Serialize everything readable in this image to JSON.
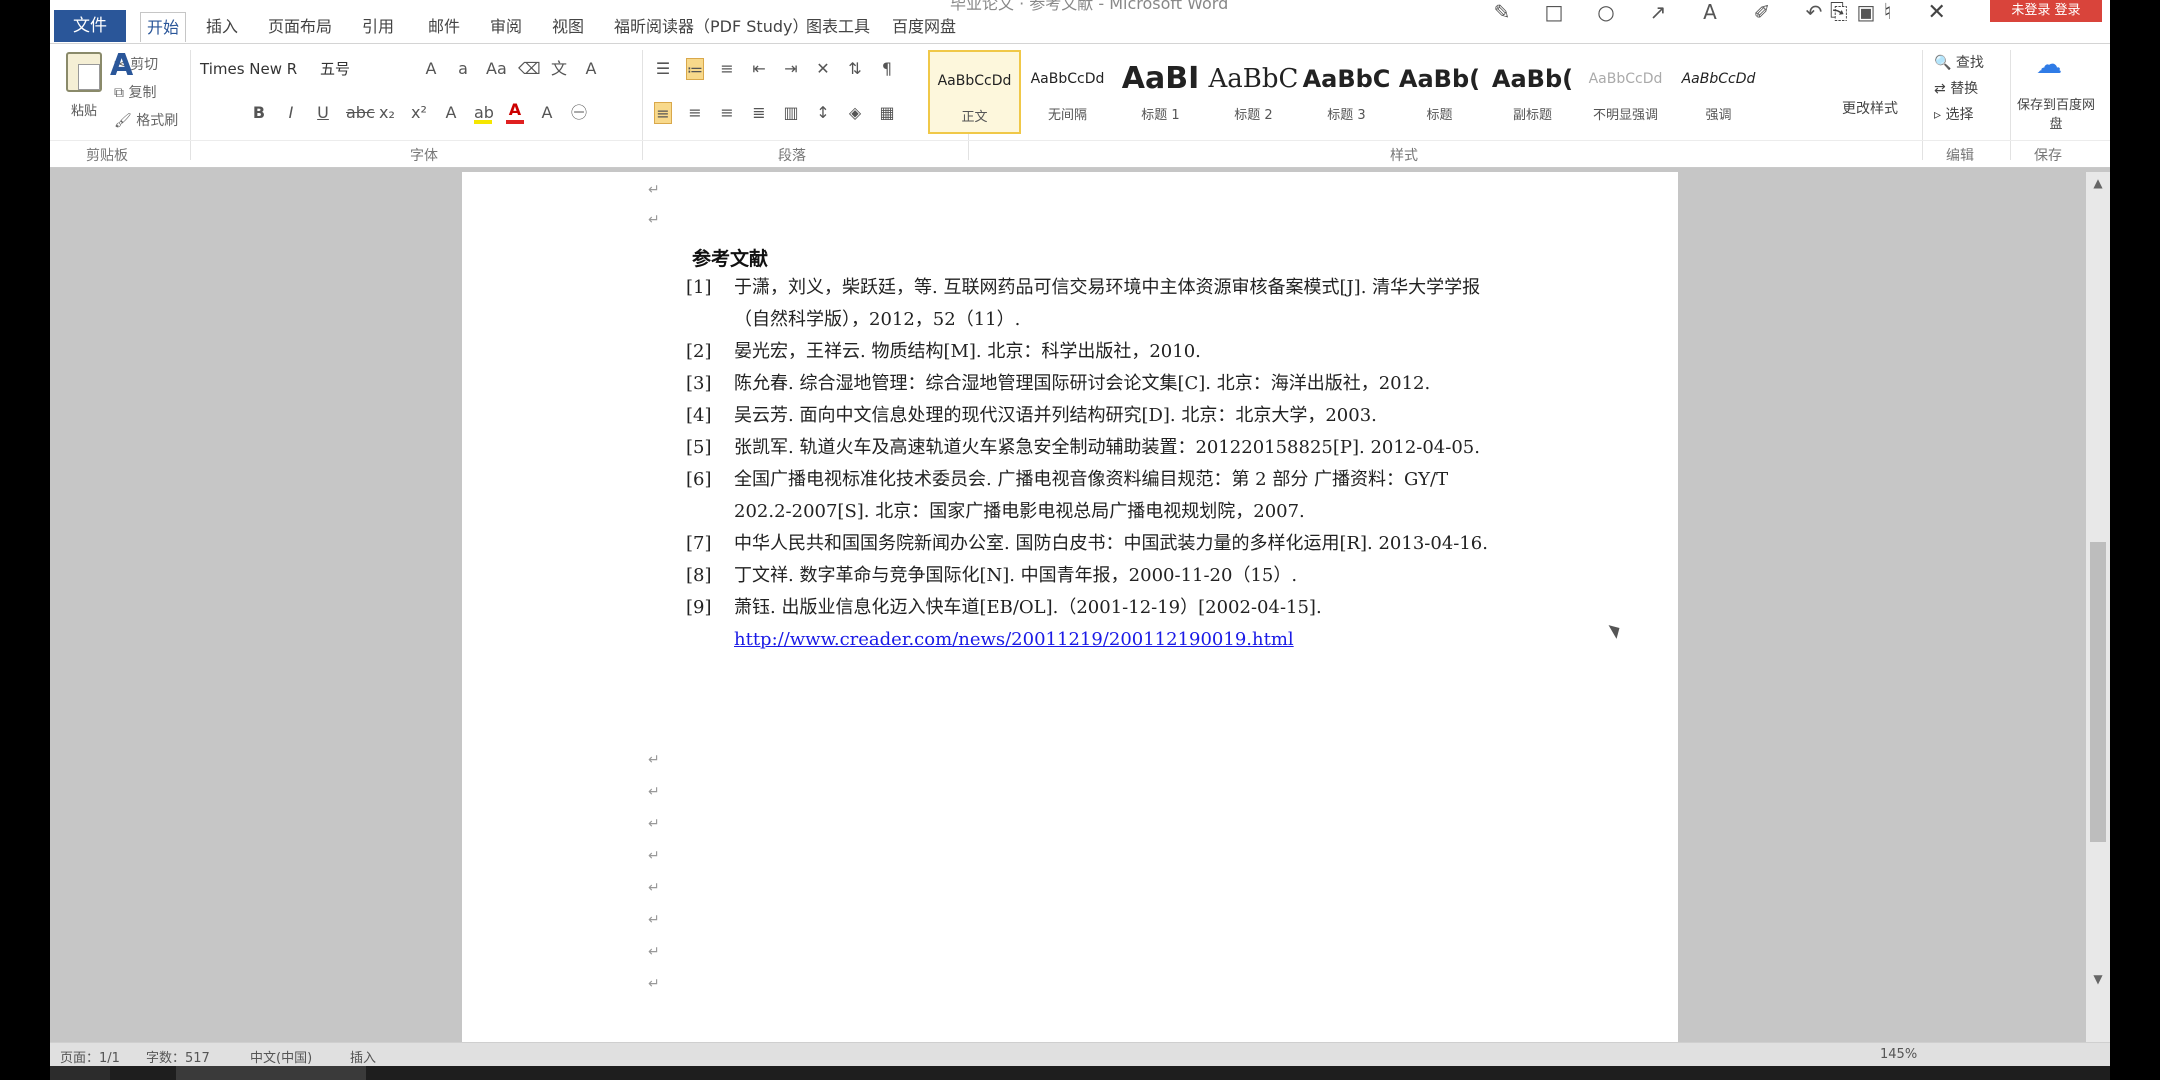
{
  "app": {
    "title": "毕业论文 · 参考文献 - Microsoft Word",
    "login": "未登录 登录"
  },
  "tabs": [
    {
      "label": "文件"
    },
    {
      "label": "开始"
    },
    {
      "label": "插入"
    },
    {
      "label": "页面布局"
    },
    {
      "label": "引用"
    },
    {
      "label": "邮件"
    },
    {
      "label": "审阅"
    },
    {
      "label": "视图"
    },
    {
      "label": "福昕阅读器（PDF Study）"
    },
    {
      "label": "图表工具"
    },
    {
      "label": "百度网盘"
    }
  ],
  "ribbon": {
    "clipboard": {
      "paste": "粘贴",
      "cut": "剪切",
      "copy": "复制",
      "format_painter": "格式刷"
    },
    "font": {
      "name": "Times New R",
      "size": "五号"
    },
    "styles": [
      {
        "sample": "AaBbCcDd",
        "name": "正文"
      },
      {
        "sample": "AaBbCcDd",
        "name": "无间隔"
      },
      {
        "sample": "AaBI",
        "name": "标题 1"
      },
      {
        "sample": "AaBbC",
        "name": "标题 2"
      },
      {
        "sample": "AaBbC",
        "name": "标题 3"
      },
      {
        "sample": "AaBb(",
        "name": "标题"
      },
      {
        "sample": "AaBb(",
        "name": "副标题"
      },
      {
        "sample": "AaBbCcDd",
        "name": "不明显强调"
      },
      {
        "sample": "AaBbCcDd",
        "name": "强调"
      }
    ],
    "change_styles": "更改样式",
    "editing": {
      "find": "查找",
      "replace": "替换",
      "select": "选择"
    },
    "save_to_cloud": "保存到百度网盘",
    "group_labels": {
      "clipboard": "剪贴板",
      "font": "字体",
      "paragraph": "段落",
      "styles": "样式",
      "editing": "编辑",
      "save": "保存"
    }
  },
  "document": {
    "heading": "参考文献",
    "references": [
      {
        "num": "[1]",
        "text": "于潇，刘义，柴跃廷，等. 互联网药品可信交易环境中主体资源审核备案模式[J]. 清华大学学报（自然科学版），2012，52（11）."
      },
      {
        "num": "[2]",
        "text": "晏光宏，王祥云. 物质结构[M]. 北京：科学出版社，2010."
      },
      {
        "num": "[3]",
        "text": "陈允春. 综合湿地管理：综合湿地管理国际研讨会论文集[C]. 北京：海洋出版社，2012."
      },
      {
        "num": "[4]",
        "text": "吴云芳. 面向中文信息处理的现代汉语并列结构研究[D]. 北京：北京大学，2003."
      },
      {
        "num": "[5]",
        "text": "张凯军. 轨道火车及高速轨道火车紧急安全制动辅助装置：201220158825[P]. 2012-04-05."
      },
      {
        "num": "[6]",
        "text": "全国广播电视标准化技术委员会. 广播电视音像资料编目规范：第 2 部分 广播资料：GY/T 202.2-2007[S]. 北京：国家广播电影电视总局广播电视规划院，2007."
      },
      {
        "num": "[7]",
        "text": "中华人民共和国国务院新闻办公室. 国防白皮书：中国武装力量的多样化运用[R]. 2013-04-16."
      },
      {
        "num": "[8]",
        "text": "丁文祥. 数字革命与竞争国际化[N]. 中国青年报，2000-11-20（15）."
      },
      {
        "num": "[9]",
        "text": "萧钰. 出版业信息化迈入快车道[EB/OL].（2001-12-19）[2002-04-15].",
        "link": "http://www.creader.com/news/20011219/200112190019.html"
      }
    ]
  },
  "status": {
    "page": "页面：1/1",
    "words": "字数：517",
    "language": "中文(中国)",
    "mode": "插入",
    "zoom": "145%"
  }
}
